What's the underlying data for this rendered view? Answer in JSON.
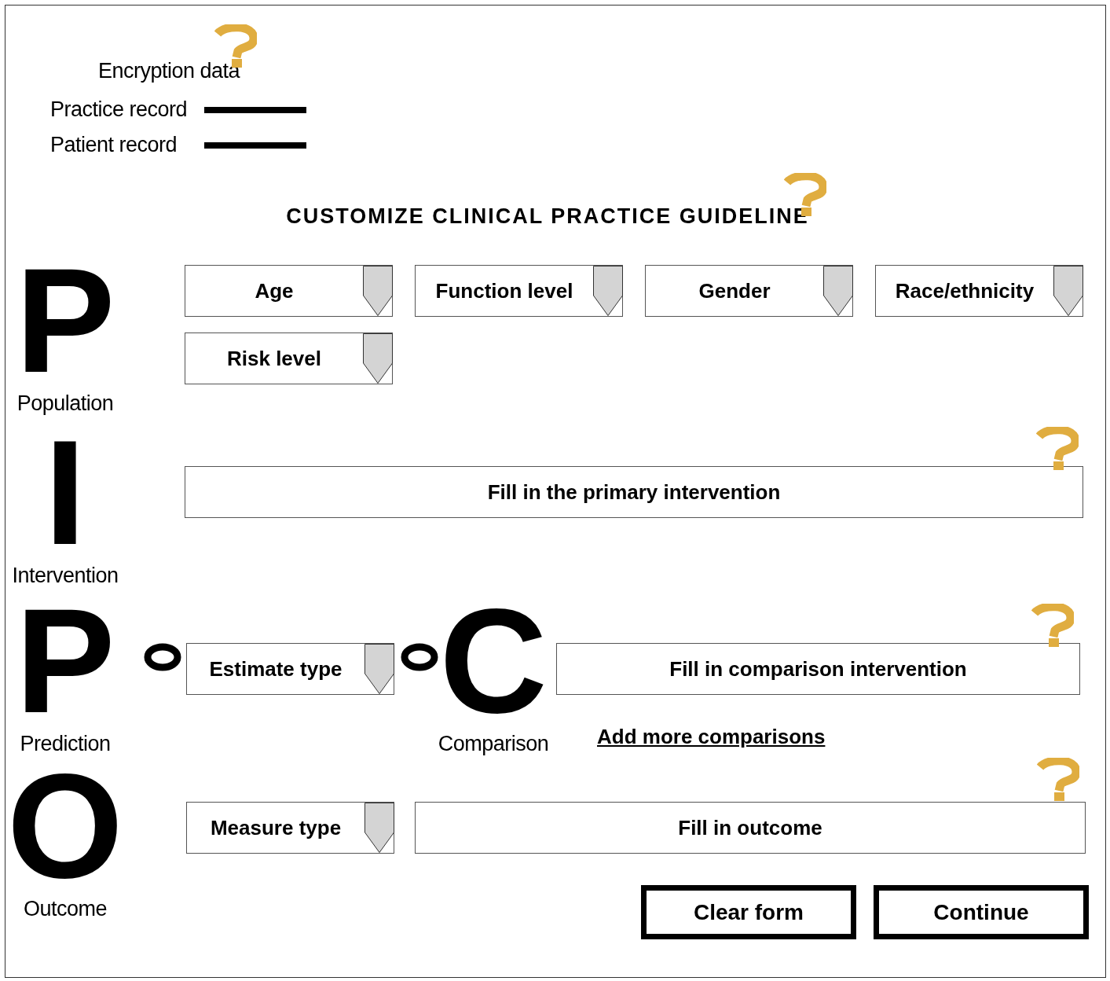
{
  "legend": {
    "title": "Encryption data",
    "items": [
      {
        "label": "Practice record"
      },
      {
        "label": "Patient record"
      }
    ]
  },
  "title": "CUSTOMIZE CLINICAL PRACTICE GUIDELINE",
  "sections": [
    {
      "kind": "population",
      "letter": "P",
      "label": "Population",
      "dropdowns": [
        "Age",
        "Function level",
        "Gender",
        "Race/ethnicity",
        "Risk level"
      ]
    },
    {
      "kind": "intervention",
      "letter": "I",
      "label": "Intervention",
      "placeholder": "Fill in the primary intervention"
    },
    {
      "kind": "prediction",
      "letter": "P",
      "label": "Prediction",
      "dropdown": "Estimate type",
      "comparison": {
        "letter": "C",
        "label": "Comparison",
        "placeholder": "Fill in comparison intervention",
        "link": "Add more comparisons"
      }
    },
    {
      "kind": "outcome",
      "letter": "O",
      "label": "Outcome",
      "dropdown": "Measure type",
      "placeholder": "Fill in outcome"
    }
  ],
  "buttons": [
    "Clear form",
    "Continue"
  ]
}
